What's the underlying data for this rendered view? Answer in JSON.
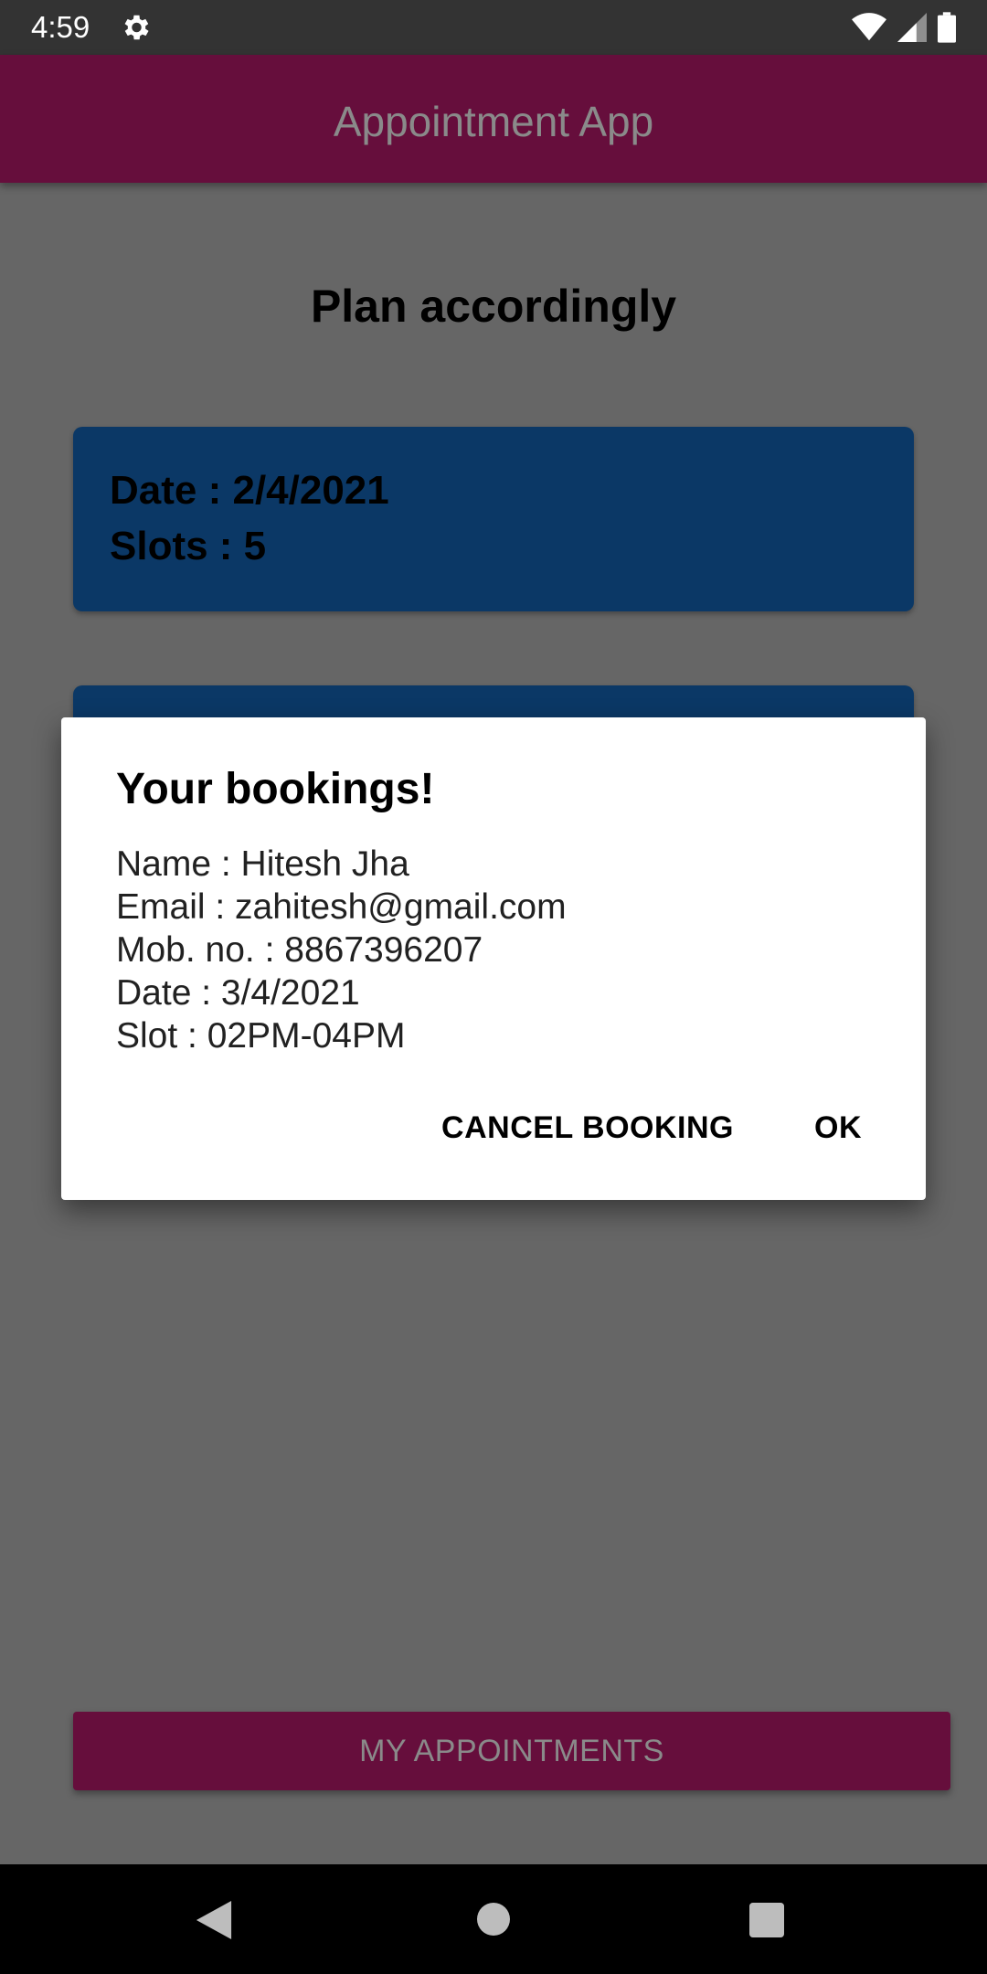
{
  "status_bar": {
    "time": "4:59",
    "icons": [
      "gear-icon",
      "wifi-icon",
      "signal-icon",
      "battery-icon"
    ]
  },
  "app_bar": {
    "title": "Appointment App"
  },
  "main": {
    "heading": "Plan accordingly",
    "cards": [
      {
        "date": "Date : 2/4/2021",
        "slots": "Slots : 5"
      }
    ],
    "my_appointments_label": "MY APPOINTMENTS"
  },
  "dialog": {
    "title": "Your bookings!",
    "lines": [
      "Name : Hitesh Jha",
      "Email : zahitesh@gmail.com",
      "Mob. no. : 8867396207",
      "Date : 3/4/2021",
      "Slot : 02PM-04PM"
    ],
    "cancel_label": "CANCEL BOOKING",
    "ok_label": "OK"
  },
  "nav_bar": {
    "icons": [
      "back-icon",
      "home-icon",
      "recents-icon"
    ]
  },
  "colors": {
    "app_bar": "#660e3c",
    "card": "#0b3866",
    "scrim": "#666666",
    "status_bar": "#333333"
  }
}
